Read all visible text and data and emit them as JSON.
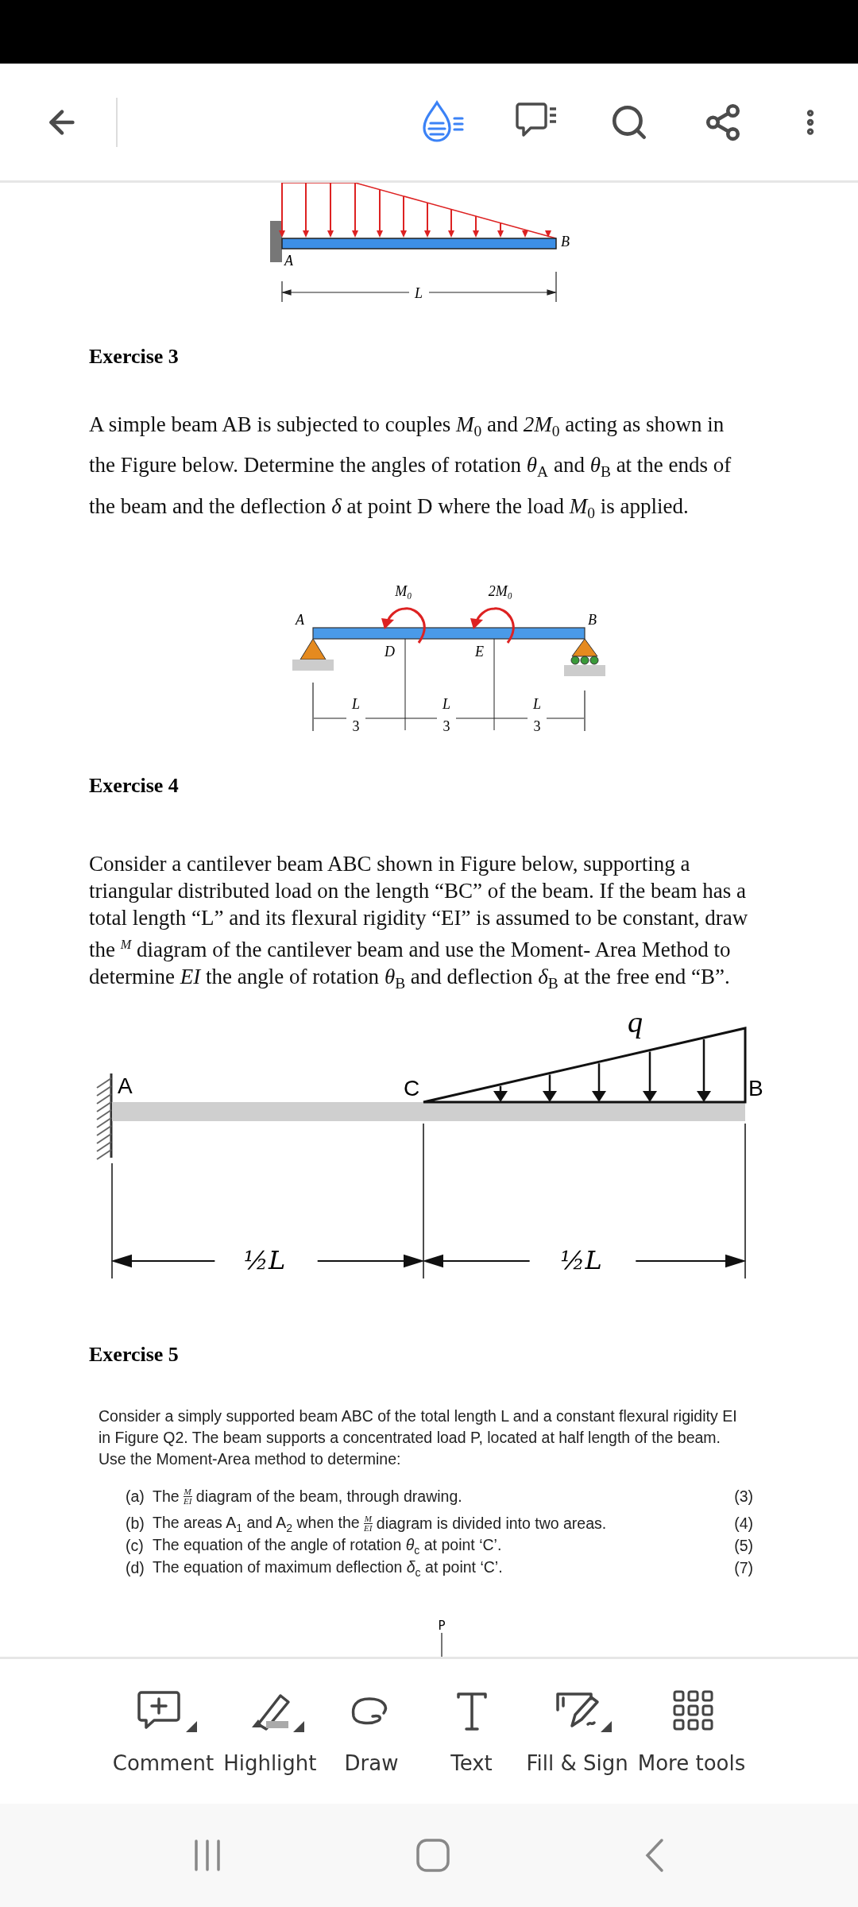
{
  "figure_1": {
    "end_a": "A",
    "end_b": "B",
    "span": "L"
  },
  "exercise_3": {
    "heading": "Exercise 3",
    "text": "A simple beam AB is subjected to couples *M*$_{0}$ and *2M*$_{0}$ acting as shown in the Figure below. Determine the angles of rotation *θ*$_{A}$ and *θ*$_{B}$ at the ends of the beam and the deflection *δ* at point D where the load *M*$_{0}$ is applied.",
    "figure": {
      "moments": [
        "M₀",
        "2M₀"
      ],
      "points": {
        "a": "A",
        "b": "B",
        "d": "D",
        "e": "E"
      },
      "spans": [
        {
          "numerator": "L",
          "denominator": "3"
        },
        {
          "numerator": "L",
          "denominator": "3"
        },
        {
          "numerator": "L",
          "denominator": "3"
        }
      ]
    }
  },
  "exercise_4": {
    "heading": "Exercise 4",
    "text": "Consider a cantilever beam ABC shown in Figure below, supporting a triangular distributed load on the length “BC” of the beam. If the beam has a total length “L” and its flexural rigidity “EI” is assumed to be constant, draw the $^{M}$ diagram of the cantilever beam and use the Moment- Area Method to determine *EI* the angle of rotation *θ*$_{B}$ and deflection *δ*$_{B}$ at the free end “B”.",
    "figure": {
      "load": "q",
      "points": {
        "a": "A",
        "c": "C",
        "b": "B"
      },
      "spans": [
        "½L",
        "½L"
      ]
    }
  },
  "exercise_5": {
    "heading": "Exercise 5",
    "text": "Consider a simply supported beam ABC of the total length L and a constant flexural rigidity EI in Figure Q2. The beam supports a concentrated load P, located at half length of the beam. Use the Moment-Area method to determine:",
    "parts": [
      {
        "label": "(a)",
        "text": "The",
        "fraction": {
          "numerator": "M",
          "denominator": "EI"
        },
        "text_after": "diagram of the beam, through drawing.",
        "marks": "(3)"
      },
      {
        "label": "(b)",
        "text": "The areas A$_{1}$ and A$_{2}$ when the",
        "fraction": {
          "numerator": "M",
          "denominator": "EI"
        },
        "text_after": "diagram is divided into two areas.",
        "marks": "(4)"
      },
      {
        "label": "(c)",
        "text": "The equation of the angle of rotation  *θ*$_{c}$ at point ‘C’.",
        "marks": "(5)"
      },
      {
        "label": "(d)",
        "text": "The equation of maximum deflection *δ*$_{c}$ at point ‘C’.",
        "marks": "(7)"
      }
    ],
    "figure": {
      "load": "P"
    }
  },
  "toolbar": [
    {
      "kind": "comment",
      "label": "Comment"
    },
    {
      "kind": "highlight",
      "label": "Highlight"
    },
    {
      "kind": "draw",
      "label": "Draw"
    },
    {
      "kind": "text",
      "label": "Text"
    },
    {
      "kind": "sign",
      "label": "Fill & Sign"
    },
    {
      "kind": "more",
      "label": "More tools"
    }
  ]
}
